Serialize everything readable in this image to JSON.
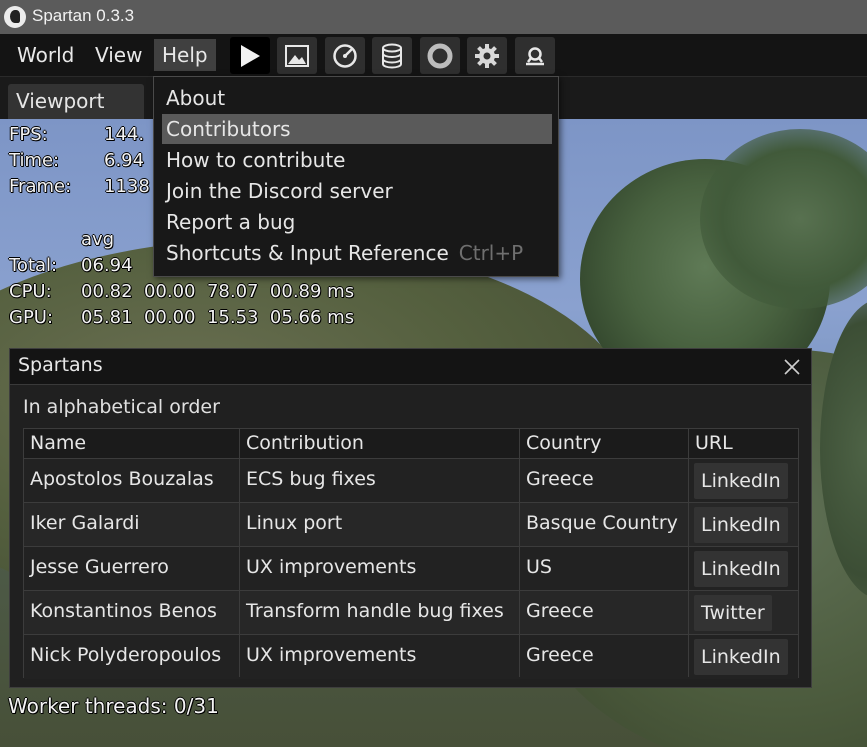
{
  "window": {
    "title": "Spartan 0.3.3"
  },
  "menubar": {
    "items": [
      {
        "label": "World"
      },
      {
        "label": "View"
      },
      {
        "label": "Help"
      }
    ],
    "toolbar_icons": [
      "play-icon",
      "image-icon",
      "profiler-icon",
      "database-icon",
      "circle-icon",
      "gear-icon",
      "search-icon"
    ]
  },
  "tabs": {
    "viewport": "Viewport"
  },
  "overlay": {
    "fps_label": "FPS:",
    "fps_value": "144.",
    "time_label": "Time:",
    "time_value": "6.94",
    "frame_label": "Frame:",
    "frame_value": "1138",
    "avg_header": "avg",
    "total_label": "Total:",
    "total_value": "06.94",
    "cpu_label": "CPU:",
    "cpu_values": "00.82  00.00  78.07  00.89 ms",
    "gpu_label": "GPU:",
    "gpu_values": "05.81  00.00  15.53  05.66 ms",
    "worker_threads": "Worker threads: 0/31"
  },
  "help_menu": {
    "items": [
      {
        "label": "About"
      },
      {
        "label": "Contributors",
        "highlighted": true
      },
      {
        "label": "How to contribute"
      },
      {
        "label": "Join the Discord server"
      },
      {
        "label": "Report a bug"
      },
      {
        "label": "Shortcuts & Input Reference",
        "shortcut": "Ctrl+P"
      }
    ]
  },
  "contributors_window": {
    "title": "Spartans",
    "subtitle": "In alphabetical order",
    "columns": [
      "Name",
      "Contribution",
      "Country",
      "URL"
    ],
    "rows": [
      {
        "name": "Apostolos Bouzalas",
        "contribution": "ECS bug fixes",
        "country": "Greece",
        "url": "LinkedIn"
      },
      {
        "name": "Iker Galardi",
        "contribution": "Linux port",
        "country": "Basque Country",
        "url": "LinkedIn"
      },
      {
        "name": "Jesse Guerrero",
        "contribution": "UX improvements",
        "country": "US",
        "url": "LinkedIn"
      },
      {
        "name": "Konstantinos Benos",
        "contribution": "Transform handle bug fixes",
        "country": "Greece",
        "url": "Twitter"
      },
      {
        "name": "Nick Polyderopoulos",
        "contribution": "UX improvements",
        "country": "Greece",
        "url": "LinkedIn"
      }
    ]
  },
  "colors": {
    "highlight": "#5a5a5a",
    "panel": "#202020",
    "menubar": "#141414",
    "titlebar": "#5b5b5b"
  }
}
